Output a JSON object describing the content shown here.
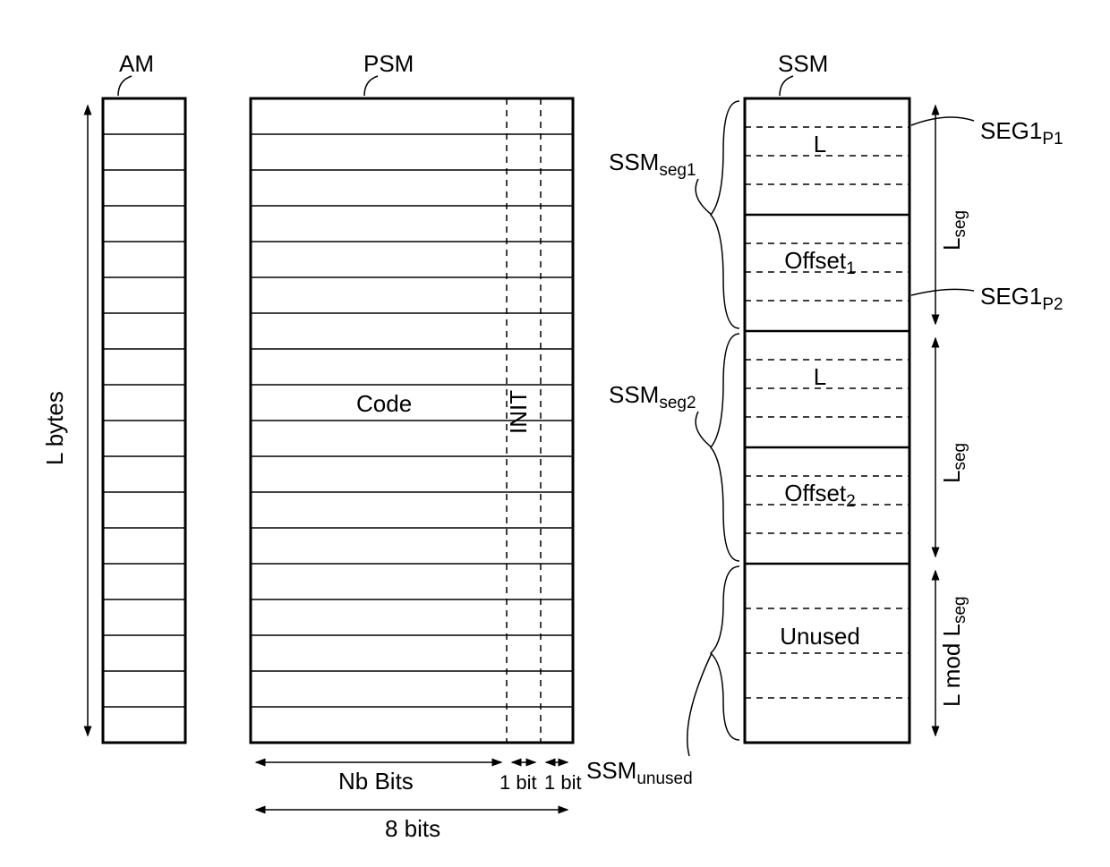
{
  "am": {
    "title": "AM",
    "height_label": "L  bytes"
  },
  "psm": {
    "title": "PSM",
    "code_label": "Code",
    "init_label": "INIT",
    "nb_bits_label": "Nb Bits",
    "one_bit_label": "1 bit",
    "total_bits_label": "8 bits"
  },
  "ssm": {
    "title": "SSM",
    "seg1_label": "SSM",
    "seg1_sub": "seg1",
    "seg2_label": "SSM",
    "seg2_sub": "seg2",
    "unused_label": "SSM",
    "unused_sub": "unused",
    "L_label": "L",
    "offset1_label": "Offset",
    "offset1_sub": "1",
    "offset2_label": "Offset",
    "offset2_sub": "2",
    "unused_content": "Unused",
    "seg1p1_label": "SEG1",
    "seg1p1_sub": "P1",
    "seg1p2_label": "SEG1",
    "seg1p2_sub": "P2",
    "lseg_label": "L",
    "lseg_sub": "seg",
    "lmod_label": "L mod L",
    "lmod_sub": "seg"
  }
}
